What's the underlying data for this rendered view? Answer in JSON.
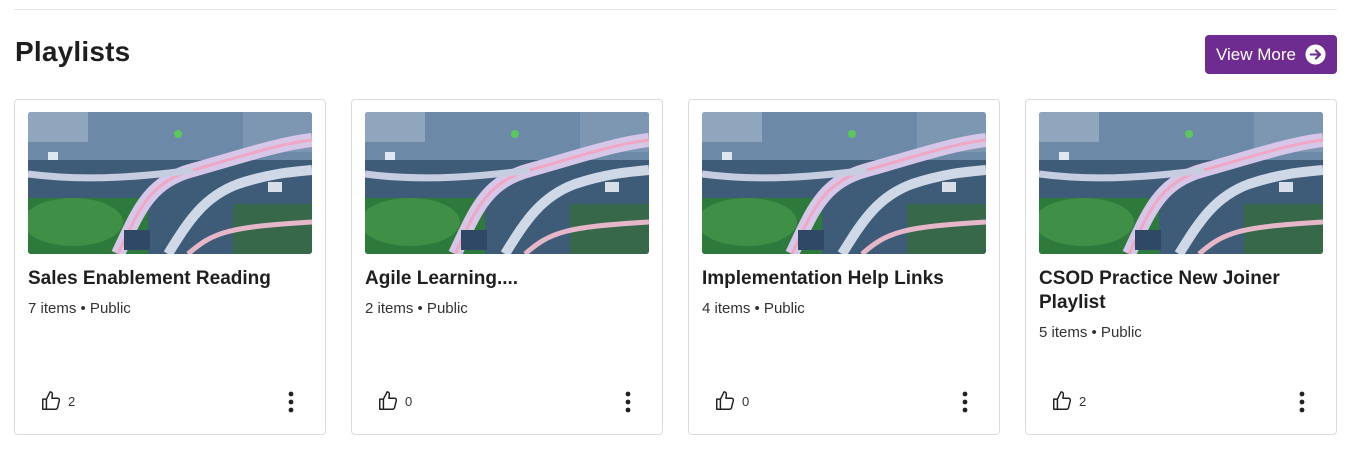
{
  "section": {
    "title": "Playlists",
    "view_more_label": "View More"
  },
  "playlists": [
    {
      "title": "Sales Enablement Reading",
      "meta": "7 items • Public",
      "likes": "2"
    },
    {
      "title": "Agile Learning....",
      "meta": "2 items • Public",
      "likes": "0"
    },
    {
      "title": "Implementation Help Links",
      "meta": "4 items • Public",
      "likes": "0"
    },
    {
      "title": "CSOD Practice New Joiner Playlist",
      "meta": "5 items • Public",
      "likes": "2"
    }
  ],
  "icons": {
    "view_more": "arrow-right-circle-icon",
    "like": "thumbs-up-icon",
    "more": "more-vertical-icon"
  },
  "colors": {
    "accent": "#6e2c91"
  }
}
